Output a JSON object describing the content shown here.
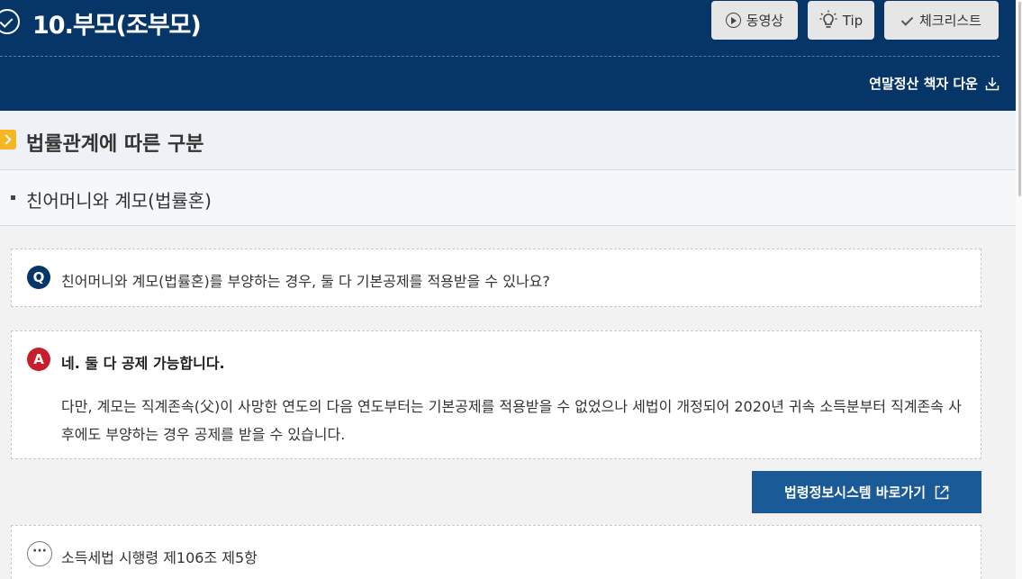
{
  "header": {
    "title": "10.부모(조부모)",
    "buttons": {
      "video_label": "동영상",
      "tip_label": "Tip",
      "checklist_label": "체크리스트"
    },
    "download_label": "연말정산 책자 다운",
    "bg_color": "#063567"
  },
  "section": {
    "title": "법률관계에 따른 구분",
    "marker_color": "#f4b622"
  },
  "subsection": {
    "title": "친어머니와 계모(법률혼)"
  },
  "qa": {
    "question_badge": "Q",
    "question": "친어머니와 계모(법률혼)를 부양하는 경우, 둘 다 기본공제를 적용받을 수 있나요?",
    "answer_badge": "A",
    "answer_headline": "네. 둘 다 공제 가능합니다.",
    "answer_body": "다만, 계모는 직계존속(父)이 사망한 연도의 다음 연도부터는 기본공제를 적용받을 수 없었으나 세법이 개정되어 2020년 귀속 소득분부터 직계존속 사후에도 부양하는 경우 공제를 받을 수 있습니다."
  },
  "law_link": {
    "label": "법령정보시스템 바로가기",
    "color": "#1a5a96"
  },
  "reference": {
    "more_icon": "···",
    "text": "소득세법 시행령 제106조 제5항"
  }
}
